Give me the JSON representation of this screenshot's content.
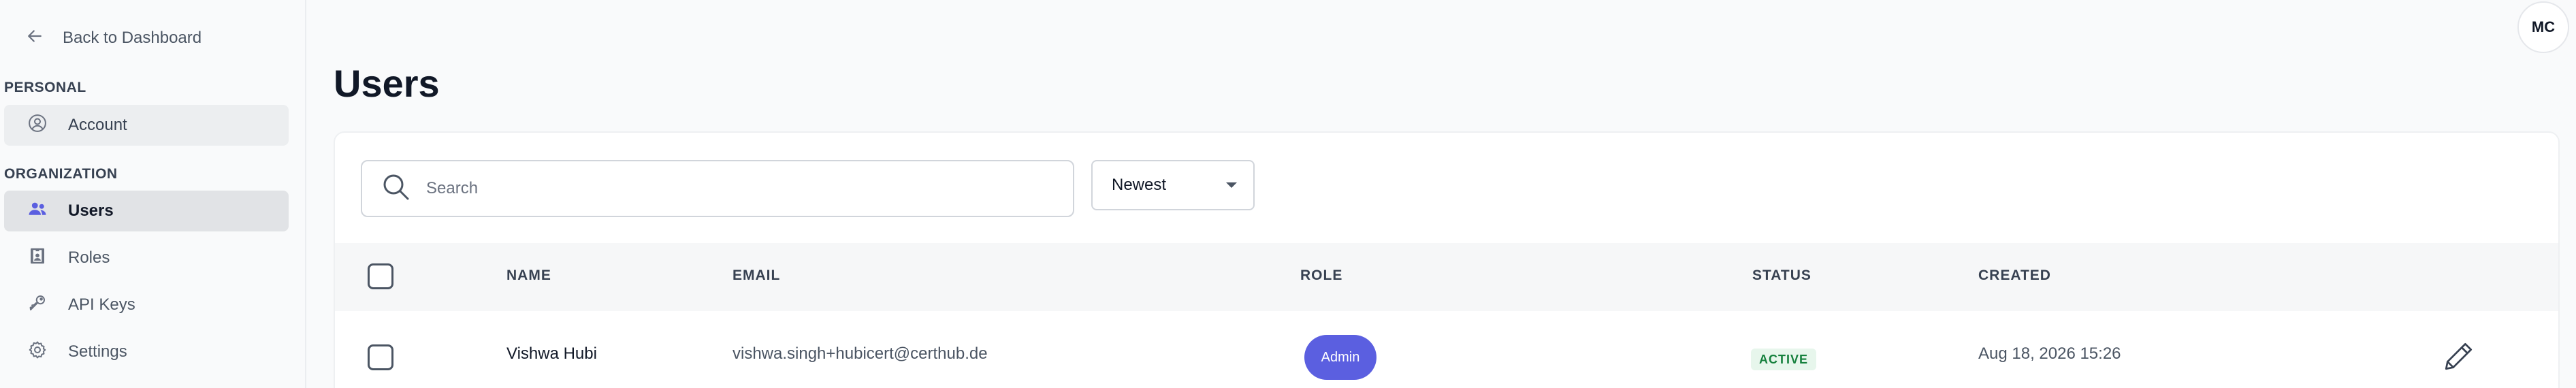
{
  "sidebar": {
    "back_label": "Back to Dashboard",
    "personal_label": "PERSONAL",
    "account_label": "Account",
    "organization_label": "ORGANIZATION",
    "items": [
      {
        "label": "Users",
        "icon": "users-icon",
        "active": true
      },
      {
        "label": "Roles",
        "icon": "badge-icon"
      },
      {
        "label": "API Keys",
        "icon": "key-icon"
      },
      {
        "label": "Settings",
        "icon": "gear-icon"
      }
    ]
  },
  "header": {
    "avatar_initials": "MC"
  },
  "page": {
    "title": "Users"
  },
  "toolbar": {
    "search_placeholder": "Search",
    "sort_value": "Newest"
  },
  "table": {
    "columns": [
      "NAME",
      "EMAIL",
      "ROLE",
      "STATUS",
      "CREATED"
    ],
    "rows": [
      {
        "name": "Vishwa Hubi",
        "email": "vishwa.singh+hubicert@certhub.de",
        "role": "Admin",
        "status": "ACTIVE",
        "created": "Aug 18, 2026 15:26"
      }
    ]
  },
  "colors": {
    "accent": "#5b5fe0",
    "status_active_bg": "#e7f6ec",
    "status_active_text": "#15803d"
  }
}
